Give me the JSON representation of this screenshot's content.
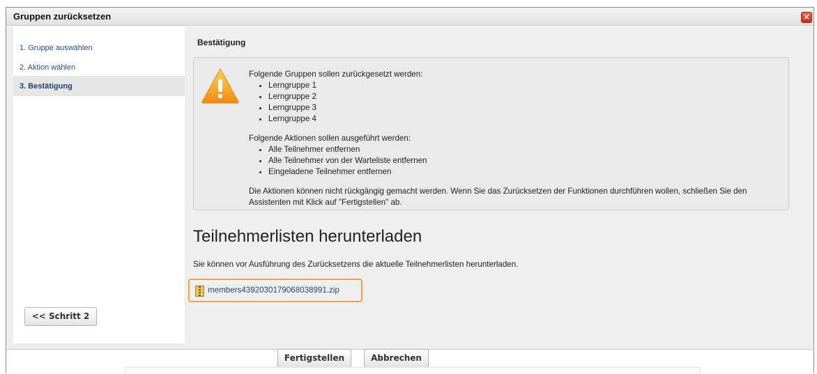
{
  "dialog": {
    "title": "Gruppen zurücksetzen",
    "close_icon": "close-icon"
  },
  "sidebar": {
    "steps": [
      {
        "label": "1. Gruppe auswählen",
        "active": false
      },
      {
        "label": "2. Aktion wählen",
        "active": false
      },
      {
        "label": "3. Bestätigung",
        "active": true
      }
    ],
    "back_button": "<< Schritt 2"
  },
  "main": {
    "section_title": "Bestätigung",
    "warning": {
      "icon": "warning-icon",
      "groups_intro": "Folgende Gruppen sollen zurückgesetzt werden:",
      "groups": [
        "Lerngruppe 1",
        "Lerngruppe 2",
        "Lerngruppe 3",
        "Lerngruppe 4"
      ],
      "actions_intro": "Folgende Aktionen sollen ausgeführt werden:",
      "actions": [
        "Alle Teilnehmer entfernen",
        "Alle Teilnehmer von der Warteliste entfernen",
        "Eingeladene Teilnehmer entfernen"
      ],
      "note": "Die Aktionen können nicht rückgängig gemacht werden. Wenn Sie das Zurücksetzen der Funktionen durchführen wollen, schließen Sie den Assistenten mit Klick auf \"Fertigstellen\" ab."
    },
    "download_heading": "Teilnehmerlisten herunterladen",
    "download_info": "Sie können vor Ausführung des Zurücksetzens die aktuelle Teilnehmerlisten herunterladen.",
    "file": {
      "icon": "zip-file-icon",
      "name": "members4392030179068038991.zip"
    }
  },
  "footer": {
    "finish_button": "Fertigstellen",
    "cancel_button": "Abbrechen"
  },
  "colors": {
    "accent_highlight": "#f0a24a",
    "link": "#1f4a8a",
    "warning": "#f6a21a"
  }
}
